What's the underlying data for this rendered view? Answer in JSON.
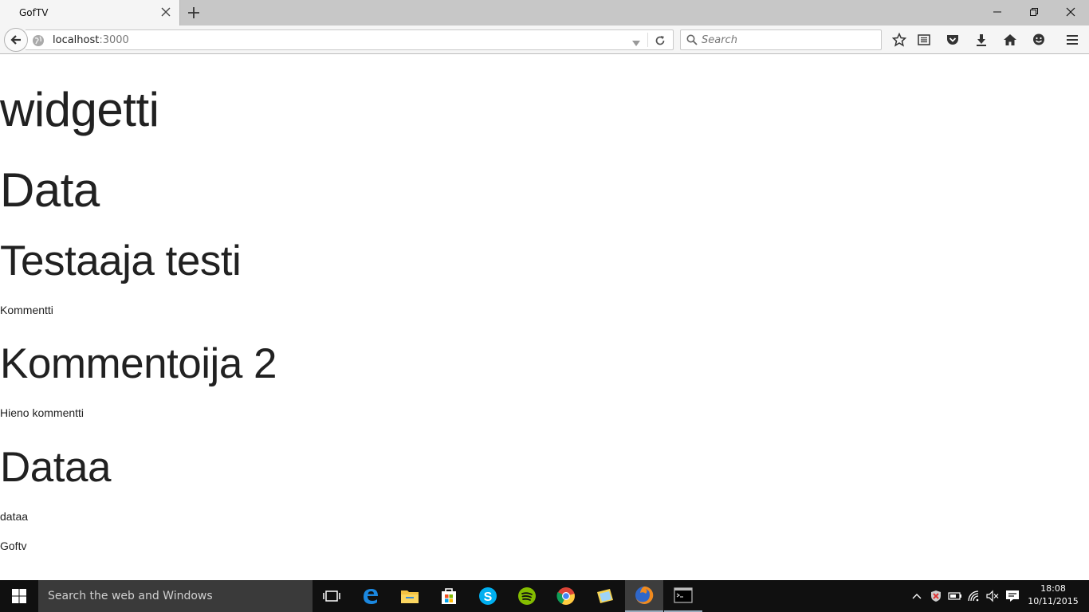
{
  "browser": {
    "tab_title": "GofTV",
    "url_host": "localhost",
    "url_port": ":3000",
    "search_placeholder": "Search"
  },
  "page": {
    "heading_1": "widgetti",
    "heading_2": "Data",
    "heading_3": "Testaaja testi",
    "text_1": "Kommentti",
    "heading_4": "Kommentoija 2",
    "text_2": "Hieno kommentti",
    "heading_5": "Dataa",
    "text_3": "dataa",
    "text_4": "Goftv"
  },
  "taskbar": {
    "search_text": "Search the web and Windows",
    "time": "18:08",
    "date": "10/11/2015"
  }
}
